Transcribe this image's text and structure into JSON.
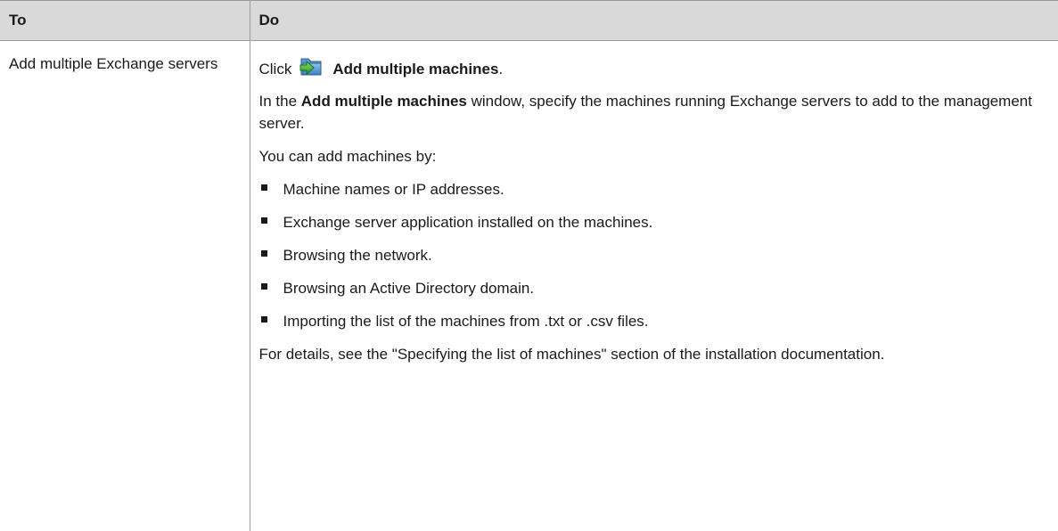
{
  "table": {
    "header": {
      "col_to": "To",
      "col_do": "Do"
    },
    "row": {
      "to": "Add multiple Exchange servers",
      "do": {
        "click_prefix": "Click",
        "click_icon": "add-multiple-machines-icon",
        "click_action": "Add multiple machines",
        "click_suffix": ".",
        "p1_prefix": "In the",
        "p1_bold": "Add multiple machines",
        "p1_suffix": "window, specify the machines running Exchange servers to add to the management server.",
        "p2": "You can add machines by:",
        "bullets": [
          "Machine names or IP addresses.",
          "Exchange server application installed on the machines.",
          "Browsing the network.",
          "Browsing an Active Directory domain.",
          "Importing the list of the machines from .txt or .csv files."
        ],
        "p3": "For details, see the \"Specifying the list of machines\" section of the installation documentation."
      }
    }
  },
  "colors": {
    "header_bg": "#d9d9d9",
    "border": "#9a9a9a",
    "text": "#1a1a1a"
  }
}
